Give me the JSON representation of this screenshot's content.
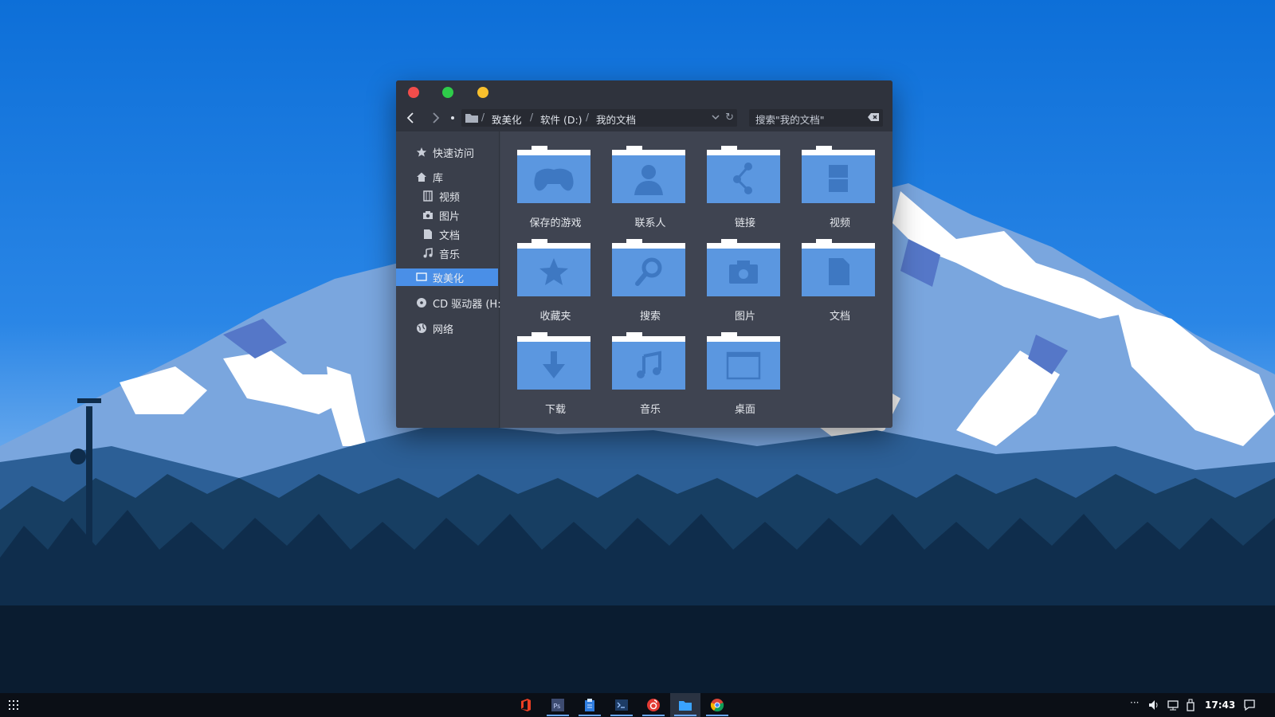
{
  "window": {
    "title_controls": [
      "close",
      "maximize",
      "minimize"
    ],
    "address_segments": [
      "致美化",
      "软件 (D:)",
      "我的文档"
    ],
    "search_placeholder": "搜索\"我的文档\""
  },
  "sidebar": {
    "quick_access": "快速访问",
    "library": "库",
    "library_items": [
      {
        "label": "视频",
        "icon": "film-icon"
      },
      {
        "label": "图片",
        "icon": "camera-icon"
      },
      {
        "label": "文档",
        "icon": "document-icon"
      },
      {
        "label": "音乐",
        "icon": "music-icon"
      }
    ],
    "selected": "致美化",
    "cd_drive": "CD 驱动器 (H:)",
    "network": "网络"
  },
  "folders": [
    {
      "label": "保存的游戏",
      "icon": "gamepad-icon"
    },
    {
      "label": "联系人",
      "icon": "person-icon"
    },
    {
      "label": "链接",
      "icon": "share-icon"
    },
    {
      "label": "视频",
      "icon": "film-icon"
    },
    {
      "label": "收藏夹",
      "icon": "star-icon"
    },
    {
      "label": "搜索",
      "icon": "magnifier-icon"
    },
    {
      "label": "图片",
      "icon": "camera-icon"
    },
    {
      "label": "文档",
      "icon": "document-icon"
    },
    {
      "label": "下载",
      "icon": "download-icon"
    },
    {
      "label": "音乐",
      "icon": "music-icon"
    },
    {
      "label": "桌面",
      "icon": "desktop-icon"
    }
  ],
  "taskbar": {
    "apps": [
      "office-icon",
      "photoshop-icon",
      "clipboard-icon",
      "terminal-icon",
      "netease-music-icon",
      "file-explorer-icon",
      "chrome-icon"
    ],
    "clock": "17:43"
  },
  "colors": {
    "folder_front": "#5b97e0",
    "folder_icon": "#3e78c2",
    "selection": "#4a8fe7",
    "window_bg": "#3a3f4b"
  }
}
